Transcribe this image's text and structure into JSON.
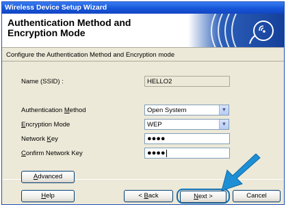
{
  "window": {
    "title": "Wireless Device Setup Wizard"
  },
  "header": {
    "title": "Authentication Method and Encryption Mode"
  },
  "subtitle": "Configure the Authentication Method and Encryption mode",
  "form": {
    "ssid": {
      "label": "Name (SSID) :",
      "value": "HELLO2"
    },
    "auth_method": {
      "label_pre": "Authentication ",
      "label_key": "M",
      "label_post": "ethod",
      "value": "Open System"
    },
    "enc_mode": {
      "label_pre": "",
      "label_key": "E",
      "label_post": "ncryption Mode",
      "value": "WEP"
    },
    "network_key": {
      "label_pre": "Network ",
      "label_key": "K",
      "label_post": "ey",
      "masked": "●●●●"
    },
    "confirm_key": {
      "label_pre": "",
      "label_key": "C",
      "label_post": "onfirm Network Key",
      "masked": "●●●●"
    }
  },
  "buttons": {
    "advanced": {
      "key": "A",
      "rest": "dvanced"
    },
    "help": {
      "key": "H",
      "rest": "elp"
    },
    "back_pre": "< ",
    "back_key": "B",
    "back_rest": "ack",
    "next_key": "N",
    "next_rest": "ext >",
    "cancel": "Cancel"
  },
  "colors": {
    "title_bar": "#1656d8",
    "dialog_bg": "#ece9d8",
    "pointer_arrow": "#1e8fd4"
  },
  "icons": {
    "wifi": "wifi-waves-icon",
    "pointer": "arrow-pointer-icon",
    "dropdown": "chevron-down-icon"
  }
}
